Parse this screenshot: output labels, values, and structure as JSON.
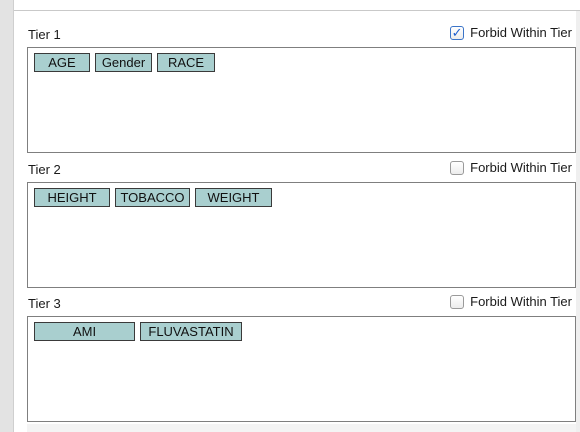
{
  "tiers": [
    {
      "title": "Tier 1",
      "forbid_label": "Forbid Within Tier",
      "forbid_checked": true,
      "variables": [
        "AGE",
        "Gender",
        "RACE"
      ]
    },
    {
      "title": "Tier 2",
      "forbid_label": "Forbid Within Tier",
      "forbid_checked": false,
      "variables": [
        "HEIGHT",
        "TOBACCO",
        "WEIGHT"
      ]
    },
    {
      "title": "Tier 3",
      "forbid_label": "Forbid Within Tier",
      "forbid_checked": false,
      "variables": [
        "AMI",
        "FLUVASTATIN"
      ]
    }
  ],
  "colors": {
    "chip_fill": "#a9cfcf",
    "chip_border": "#3a3a3a",
    "check_accent": "#1f5fcf"
  },
  "icons": {
    "checked_glyph": "check-icon"
  }
}
